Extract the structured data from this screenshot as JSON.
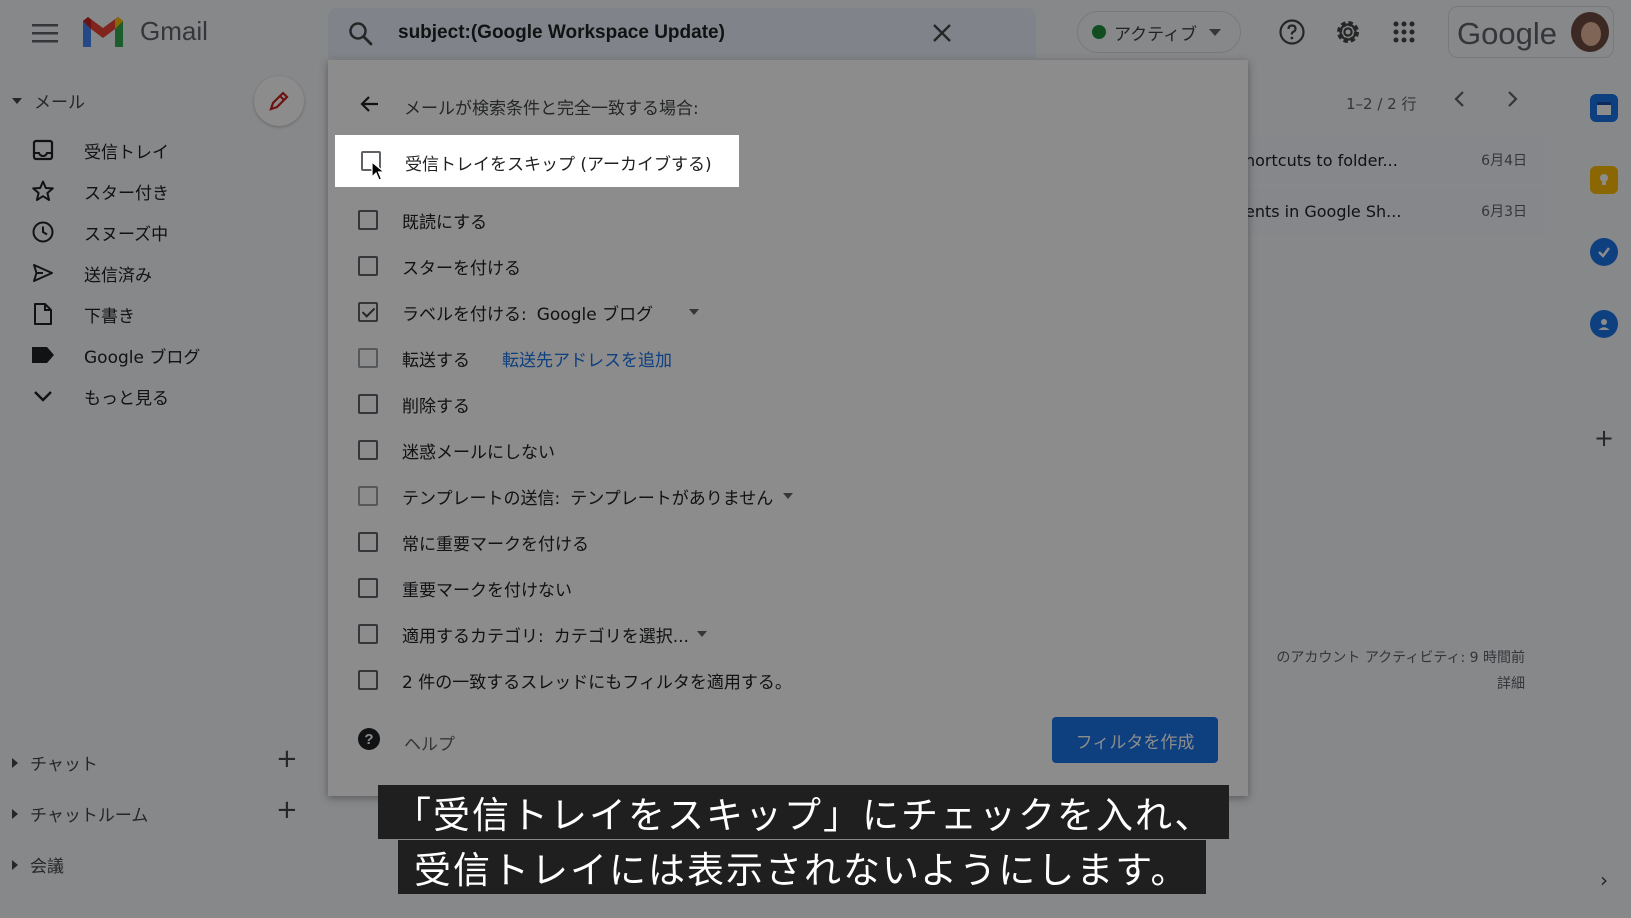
{
  "header": {
    "app_name": "Gmail",
    "search_query": "subject:(Google Workspace Update)",
    "status_label": "アクティブ",
    "brand_word": "Google"
  },
  "sidebar": {
    "mail_section": "メール",
    "items": [
      {
        "label": "受信トレイ",
        "icon": "inbox-icon"
      },
      {
        "label": "スター付き",
        "icon": "star-icon"
      },
      {
        "label": "スヌーズ中",
        "icon": "clock-icon"
      },
      {
        "label": "送信済み",
        "icon": "send-icon"
      },
      {
        "label": "下書き",
        "icon": "draft-icon"
      },
      {
        "label": "Google ブログ",
        "icon": "label-icon"
      },
      {
        "label": "もっと見る",
        "icon": "chevron-down-icon"
      }
    ],
    "chat_section": "チャット",
    "rooms_section": "チャットルーム",
    "meet_section": "会議"
  },
  "mail_list": {
    "paging": "1–2 / 2 行",
    "rows": [
      {
        "subject": "hortcuts to folder...",
        "date": "6月4日"
      },
      {
        "subject": "ents in Google Sh...",
        "date": "6月3日"
      }
    ],
    "activity": "のアカウント アクティビティ: 9 時間前",
    "details": "詳細"
  },
  "filter_panel": {
    "title": "メールが検索条件と完全一致する場合:",
    "options": [
      {
        "label": "受信トレイをスキップ (アーカイブする)",
        "checked": false
      },
      {
        "label": "既読にする",
        "checked": false
      },
      {
        "label": "スターを付ける",
        "checked": false
      },
      {
        "label": "ラベルを付ける:",
        "value": "Google ブログ",
        "checked": true
      },
      {
        "label": "転送する",
        "link": "転送先アドレスを追加",
        "checked": false
      },
      {
        "label": "削除する",
        "checked": false
      },
      {
        "label": "迷惑メールにしない",
        "checked": false
      },
      {
        "label": "テンプレートの送信:",
        "value": "テンプレートがありません",
        "checked": false
      },
      {
        "label": "常に重要マークを付ける",
        "checked": false
      },
      {
        "label": "重要マークを付けない",
        "checked": false
      },
      {
        "label": "適用するカテゴリ:",
        "value": "カテゴリを選択...",
        "checked": false
      },
      {
        "label": "2 件の一致するスレッドにもフィルタを適用する。",
        "checked": false
      }
    ],
    "help": "ヘルプ",
    "create_button": "フィルタを作成"
  },
  "subtitles": {
    "line1": "「受信トレイをスキップ」にチェックを入れ、",
    "line2": "受信トレイには表示されないようにします。"
  },
  "colors": {
    "accent": "#1a73e8",
    "status_green": "#1e8e3e",
    "gmail_red": "#ea4335"
  }
}
